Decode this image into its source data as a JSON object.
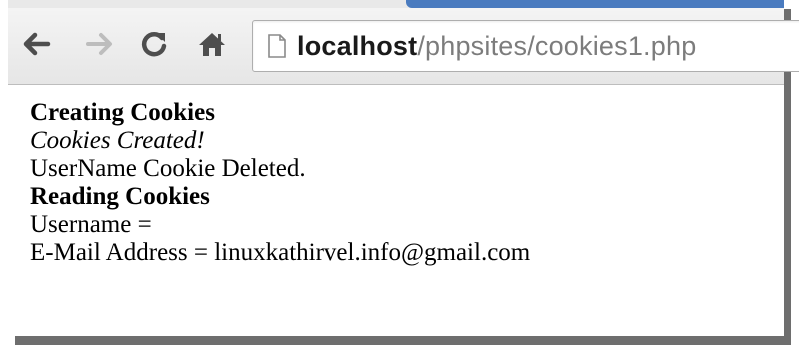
{
  "browser": {
    "address_bar": {
      "host": "localhost",
      "path": "/phpsites/cookies1.php"
    },
    "icons": {
      "back": "back-arrow-icon",
      "forward": "forward-arrow-icon",
      "reload": "reload-icon",
      "home": "home-icon",
      "page": "page-icon"
    }
  },
  "page": {
    "lines": {
      "creating_heading": "Creating Cookies",
      "cookies_created": "Cookies Created!",
      "username_deleted": "UserName Cookie Deleted.",
      "reading_heading": "Reading Cookies",
      "username_line": "Username =",
      "email_line": "E-Mail Address = linuxkathirvel.info@gmail.com"
    }
  },
  "colors": {
    "tab_accent": "#4a7bbf",
    "frame_shadow": "#6e6e6e",
    "url_path": "#7c7c7c"
  }
}
